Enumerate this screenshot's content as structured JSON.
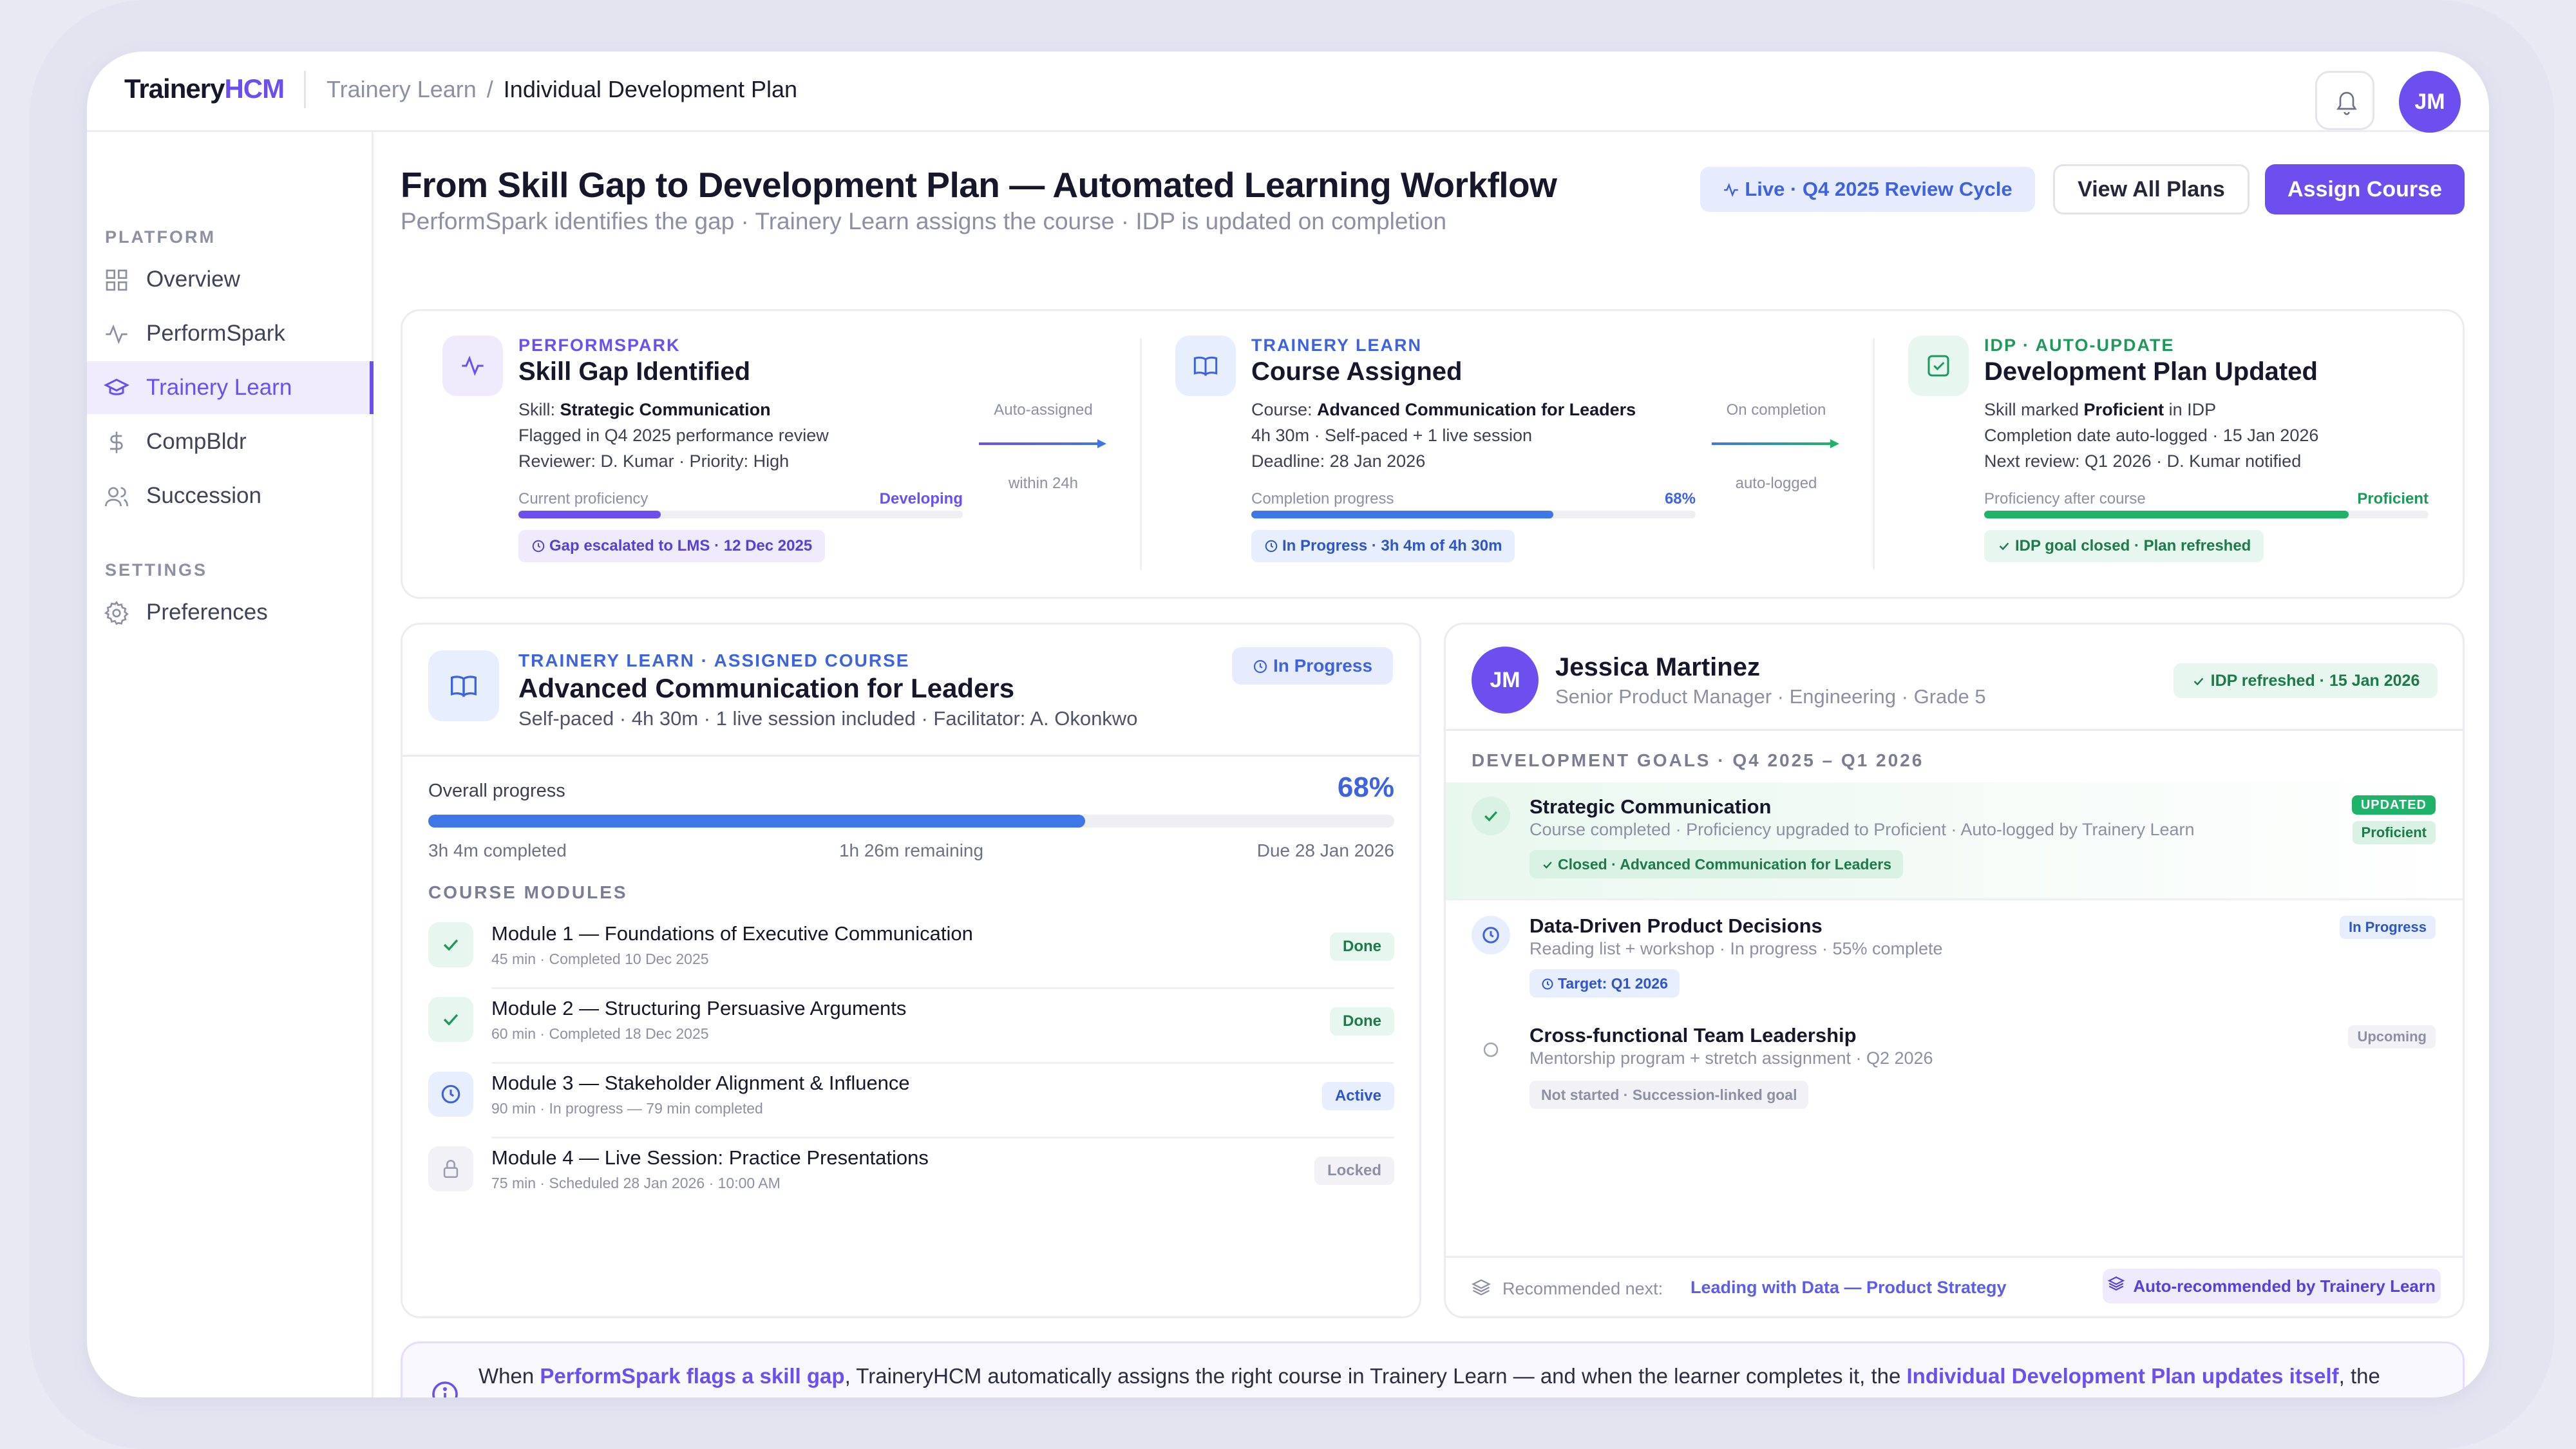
{
  "app": {
    "logo_main": "Trainery",
    "logo_accent": "HCM",
    "breadcrumb_root": "Trainery Learn",
    "breadcrumb_sep": "/",
    "breadcrumb_current": "Individual Development Plan",
    "user_initials": "JM"
  },
  "sidebar": {
    "platform_heading": "PLATFORM",
    "settings_heading": "SETTINGS",
    "items": [
      {
        "label": "Overview",
        "icon": "grid-icon",
        "active": false
      },
      {
        "label": "PerformSpark",
        "icon": "pulse-icon",
        "active": false
      },
      {
        "label": "Trainery Learn",
        "icon": "graduation-cap-icon",
        "active": true
      },
      {
        "label": "CompBldr",
        "icon": "dollar-icon",
        "active": false
      },
      {
        "label": "Succession",
        "icon": "users-icon",
        "active": false
      }
    ],
    "settings_items": [
      {
        "label": "Preferences",
        "icon": "gear-icon"
      }
    ]
  },
  "header": {
    "title": "From Skill Gap to Development Plan — Automated Learning Workflow",
    "subtitle": "PerformSpark identifies the gap · Trainery Learn assigns the course · IDP is updated on completion",
    "live_pill": "Live · Q4 2025 Review Cycle",
    "view_all_label": "View All Plans",
    "assign_label": "Assign Course"
  },
  "workflow": {
    "steps": [
      {
        "tag": "PERFORMSPARK",
        "title": "Skill Gap Identified",
        "line1_prefix": "Skill: ",
        "line1_bold": "Strategic Communication",
        "line1_suffix": "",
        "line2": "Flagged in Q4 2025 performance review",
        "line3": "Reviewer: D. Kumar · Priority: High",
        "progress_label": "Current proficiency",
        "progress_value": "Developing",
        "progress_fraction": 0.32,
        "chip": "Gap escalated to LMS · 12 Dec 2025"
      },
      {
        "tag": "TRAINERY LEARN",
        "title": "Course Assigned",
        "line1_prefix": "Course: ",
        "line1_bold": "Advanced Communication for Leaders",
        "line1_suffix": "",
        "line2": "4h 30m · Self-paced + 1 live session",
        "line3": "Deadline: 28 Jan 2026",
        "progress_label": "Completion progress",
        "progress_value": "68%",
        "progress_fraction": 0.68,
        "chip": "In Progress · 3h 4m of 4h 30m"
      },
      {
        "tag": "IDP · AUTO-UPDATE",
        "title": "Development Plan Updated",
        "line1_prefix": "Skill marked ",
        "line1_bold": "Proficient",
        "line1_suffix": " in IDP",
        "line2": "Completion date auto-logged · 15 Jan 2026",
        "line3": "Next review: Q1 2026 · D. Kumar notified",
        "progress_label": "Proficiency after course",
        "progress_value": "Proficient",
        "progress_fraction": 0.82,
        "chip": "IDP goal closed · Plan refreshed"
      }
    ],
    "connectors": [
      {
        "top": "Auto-assigned",
        "bottom": "within 24h"
      },
      {
        "top": "On completion",
        "bottom": "auto-logged"
      }
    ]
  },
  "course": {
    "tag": "TRAINERY LEARN · ASSIGNED COURSE",
    "title": "Advanced Communication for Leaders",
    "subtitle": "Self-paced · 4h 30m · 1 live session included · Facilitator: A. Okonkwo",
    "status": "In Progress",
    "overall_label": "Overall progress",
    "overall_value": "68%",
    "overall_fraction": 0.68,
    "completed": "3h 4m completed",
    "remaining": "1h 26m remaining",
    "due": "Due 28 Jan 2026",
    "modules_heading": "COURSE MODULES",
    "modules": [
      {
        "title": "Module 1 — Foundations of Executive Communication",
        "meta": "45 min · Completed 10 Dec 2025",
        "status": "Done",
        "icon": "check-icon"
      },
      {
        "title": "Module 2 — Structuring Persuasive Arguments",
        "meta": "60 min · Completed 18 Dec 2025",
        "status": "Done",
        "icon": "check-icon"
      },
      {
        "title": "Module 3 — Stakeholder Alignment & Influence",
        "meta": "90 min · In progress — 79 min completed",
        "status": "Active",
        "icon": "clock-icon"
      },
      {
        "title": "Module 4 — Live Session: Practice Presentations",
        "meta": "75 min · Scheduled 28 Jan 2026 · 10:00 AM",
        "status": "Locked",
        "icon": "lock-icon"
      }
    ]
  },
  "idp": {
    "initials": "JM",
    "name": "Jessica Martinez",
    "role": "Senior Product Manager · Engineering · Grade 5",
    "refreshed": "IDP refreshed · 15 Jan 2026",
    "goals_heading": "DEVELOPMENT GOALS · Q4 2025 – Q1 2026",
    "goals": [
      {
        "title": "Strategic Communication",
        "sub": "Course completed · Proficiency upgraded to Proficient · Auto-logged by Trainery Learn",
        "chip": "Closed · Advanced Communication for Leaders",
        "badge": "UPDATED",
        "badge2": "Proficient"
      },
      {
        "title": "Data-Driven Product Decisions",
        "sub": "Reading list + workshop · In progress · 55% complete",
        "chip": "Target: Q1 2026",
        "badge": "In Progress"
      },
      {
        "title": "Cross-functional Team Leadership",
        "sub": "Mentorship program + stretch assignment · Q2 2026",
        "chip": "Not started · Succession-linked goal",
        "badge": "Upcoming"
      }
    ],
    "recommended_label": "Recommended next:",
    "recommended_link": "Leading with Data — Product Strategy",
    "recommended_chip": "Auto-recommended by Trainery Learn"
  },
  "info": {
    "p1": "When ",
    "h1": "PerformSpark flags a skill gap",
    "p2": ", TraineryHCM automatically assigns the right course in Trainery Learn — and when the learner completes it, the ",
    "h2": "Individual Development Plan updates itself",
    "p3": ", the manager is notified, and the next recommended course is already queued. Zero manual handoffs, zero data entry."
  },
  "colors": {
    "accent": "#6d4ff0",
    "blue": "#3e63de",
    "green": "#1d9a5a"
  }
}
